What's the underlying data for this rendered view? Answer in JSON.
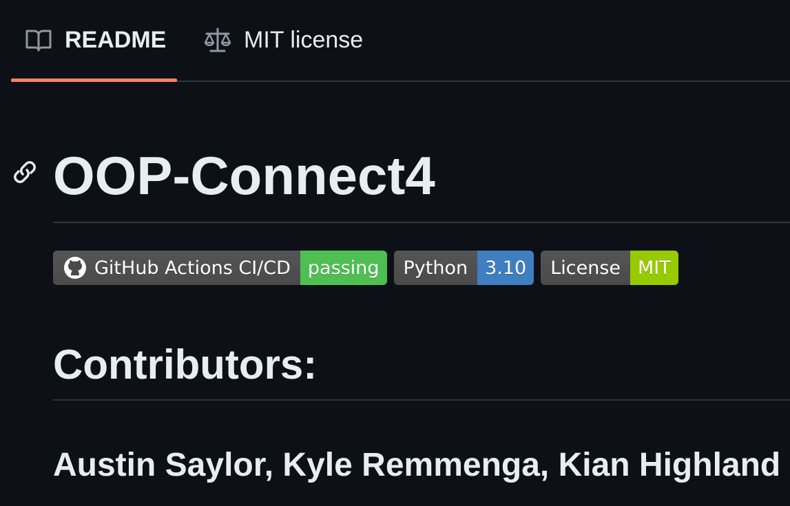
{
  "tabs": [
    {
      "label": "README",
      "icon": "book-icon",
      "active": true
    },
    {
      "label": "MIT license",
      "icon": "scale-icon",
      "active": false
    }
  ],
  "readme": {
    "title": "OOP-Connect4",
    "badges": [
      {
        "left": "GitHub Actions CI/CD",
        "right": "passing",
        "icon": "github-icon",
        "color": "#4fbf52"
      },
      {
        "left": "Python",
        "right": "3.10",
        "color": "#3f7ec0"
      },
      {
        "left": "License",
        "right": "MIT",
        "color": "#97ca00"
      }
    ],
    "contributors_heading": "Contributors:",
    "contributors": "Austin Saylor, Kyle Remmenga, Kian Highland"
  },
  "colors": {
    "background": "#0d1117",
    "text": "#e6edf3",
    "border": "#30363d",
    "tab_underline": "#f78166"
  }
}
